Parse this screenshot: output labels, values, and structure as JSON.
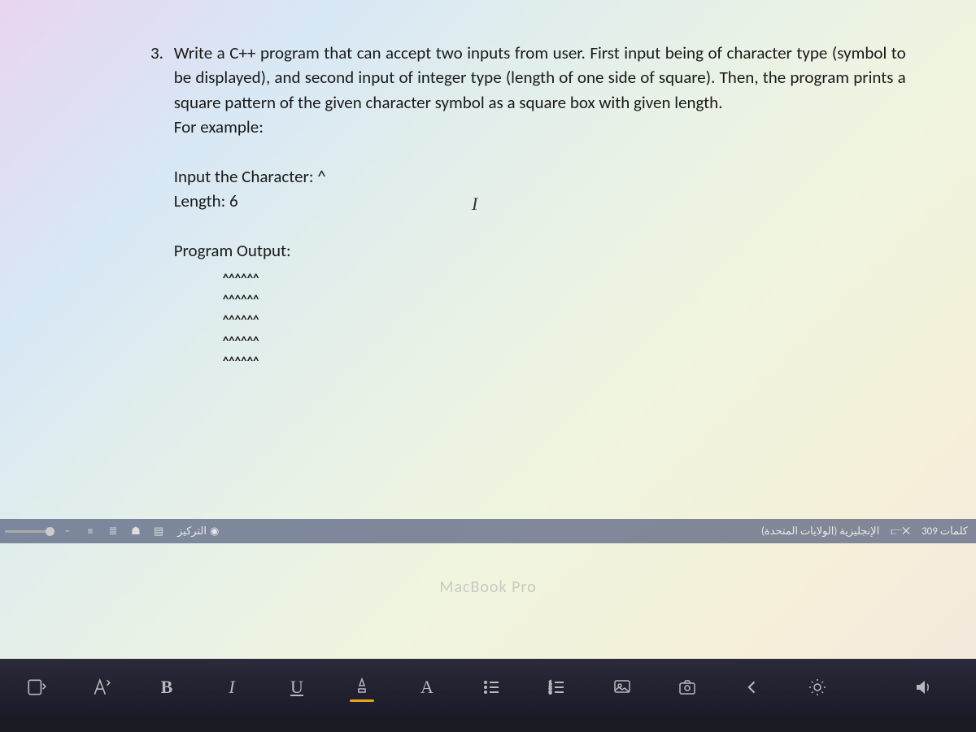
{
  "question": {
    "number": "3.",
    "text": "Write a C++ program that can accept two inputs from user. First input being of character type (symbol to be displayed), and second input of integer type (length of one side of square). Then, the program prints a square pattern of the given character symbol as a square box with given length.",
    "example_label": "For example:",
    "input_char_label": "Input the Character: ^",
    "length_label": "Length: 6",
    "output_label": "Program Output:",
    "output_lines": [
      "^^^^^^",
      "^^^^^^",
      "^^^^^^",
      "^^^^^^",
      "^^^^^^"
    ]
  },
  "statusbar": {
    "zoom_minus": "−",
    "focus_label": "التركيز",
    "language": "الإنجليزية (الولايات المتحدة)",
    "word_count": "309 كلمات"
  },
  "macbook": "MacBook Pro",
  "touchbar": {
    "bold": "B",
    "italic": "I",
    "underline": "U",
    "font": "A"
  }
}
